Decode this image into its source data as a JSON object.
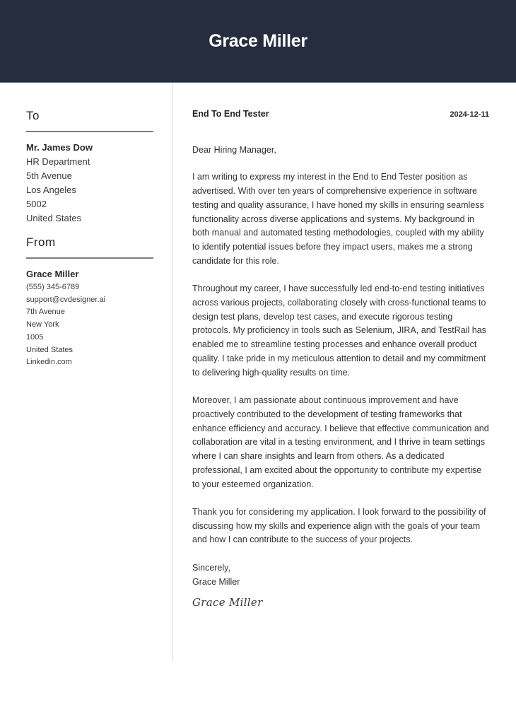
{
  "header": {
    "name": "Grace Miller"
  },
  "sidebar": {
    "to": {
      "title": "To",
      "name": "Mr. James Dow",
      "lines": [
        "HR Department",
        "5th Avenue",
        "Los Angeles",
        "5002",
        "United States"
      ]
    },
    "from": {
      "title": "From",
      "name": "Grace Miller",
      "lines": [
        "(555) 345-6789",
        "support@cvdesigner.ai",
        "7th Avenue",
        "New York",
        "1005",
        "United States",
        "Linkedin.com"
      ]
    }
  },
  "letter": {
    "job_title": "End To End Tester",
    "date": "2024-12-11",
    "salutation": "Dear Hiring Manager,",
    "paragraphs": [
      "I am writing to express my interest in the End to End Tester position as advertised. With over ten years of comprehensive experience in software testing and quality assurance, I have honed my skills in ensuring seamless functionality across diverse applications and systems. My background in both manual and automated testing methodologies, coupled with my ability to identify potential issues before they impact users, makes me a strong candidate for this role.",
      "Throughout my career, I have successfully led end-to-end testing initiatives across various projects, collaborating closely with cross-functional teams to design test plans, develop test cases, and execute rigorous testing protocols. My proficiency in tools such as Selenium, JIRA, and TestRail has enabled me to streamline testing processes and enhance overall product quality. I take pride in my meticulous attention to detail and my commitment to delivering high-quality results on time.",
      "Moreover, I am passionate about continuous improvement and have proactively contributed to the development of testing frameworks that enhance efficiency and accuracy. I believe that effective communication and collaboration are vital in a testing environment, and I thrive in team settings where I can share insights and learn from others. As a dedicated professional, I am excited about the opportunity to contribute my expertise to your esteemed organization.",
      "Thank you for considering my application. I look forward to the possibility of discussing how my skills and experience align with the goals of your team and how I can contribute to the success of your projects."
    ],
    "closing": "Sincerely,",
    "closing_name": "Grace Miller",
    "signature": "Grace Miller"
  }
}
